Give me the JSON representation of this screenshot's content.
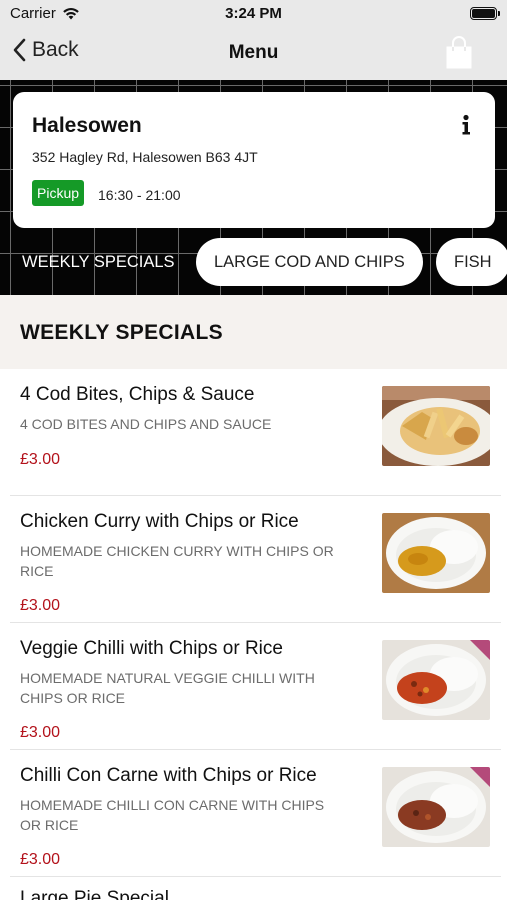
{
  "status_bar": {
    "carrier": "Carrier",
    "time": "3:24 PM"
  },
  "nav": {
    "back_label": "Back",
    "title": "Menu"
  },
  "store": {
    "name": "Halesowen",
    "address": "352 Hagley Rd, Halesowen B63 4JT",
    "pickup_label": "Pickup",
    "pickup_hours": "16:30 - 21:00"
  },
  "tabs": [
    {
      "label": "WEEKLY SPECIALS"
    },
    {
      "label": "LARGE COD AND CHIPS"
    },
    {
      "label": "FISH"
    }
  ],
  "section": {
    "title": "WEEKLY SPECIALS"
  },
  "items": [
    {
      "name": "4 Cod Bites, Chips & Sauce",
      "description": "4 COD BITES AND CHIPS AND SAUCE",
      "price": "£3.00"
    },
    {
      "name": "Chicken Curry with Chips or Rice",
      "description": "HOMEMADE CHICKEN CURRY WITH CHIPS OR RICE",
      "price": "£3.00"
    },
    {
      "name": "Veggie Chilli with Chips or Rice",
      "description": "HOMEMADE NATURAL  VEGGIE CHILLI WITH CHIPS OR RICE",
      "price": "£3.00"
    },
    {
      "name": "Chilli Con Carne with Chips or Rice",
      "description": "HOMEMADE CHILLI CON CARNE WITH CHIPS OR RICE",
      "price": "£3.00"
    }
  ],
  "partial_item": {
    "name": "Large Pie Special"
  },
  "colors": {
    "price": "#b3121b",
    "pickup_badge": "#159a27",
    "section_bg": "#f5f2ef"
  },
  "icons": {
    "back": "chevron-left-icon",
    "bag": "shopping-bag-icon",
    "info": "info-icon",
    "wifi": "wifi-icon",
    "battery": "battery-icon"
  }
}
